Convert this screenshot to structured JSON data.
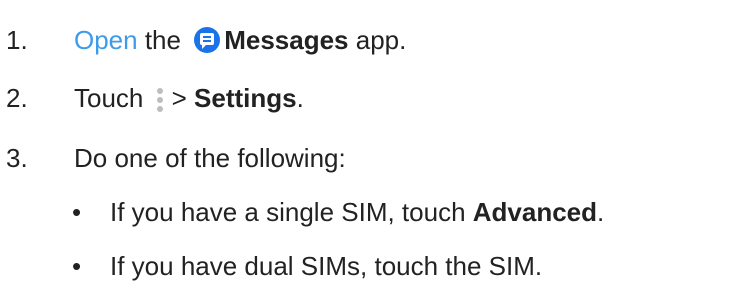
{
  "steps": [
    {
      "number": "1.",
      "link": "Open",
      "text_a": " the ",
      "icon": "messages-app-icon",
      "bold": "Messages",
      "text_b": " app."
    },
    {
      "number": "2.",
      "text_a": "Touch ",
      "icon": "more-options-icon",
      "text_b": "> ",
      "bold": "Settings",
      "text_c": "."
    },
    {
      "number": "3.",
      "text": "Do one of the following:"
    }
  ],
  "sub_items": [
    {
      "bullet": "•",
      "text": "If you have a single SIM, touch ",
      "bold": "Advanced",
      "end": "."
    },
    {
      "bullet": "•",
      "text": "If you have dual SIMs, touch the SIM."
    }
  ],
  "colors": {
    "link": "#3d9bea",
    "text": "#222222",
    "messages_icon": "#1a73e8",
    "dots_icon": "#bdbdbd"
  }
}
